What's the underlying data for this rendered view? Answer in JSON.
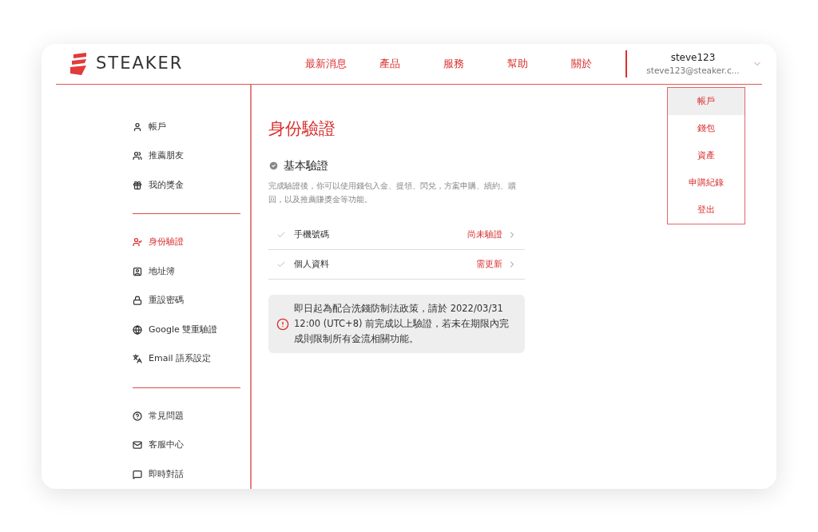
{
  "logo": {
    "text": "STEAKER"
  },
  "nav": [
    "最新消息",
    "產品",
    "服務",
    "幫助",
    "關於"
  ],
  "user": {
    "name": "steve123",
    "email": "steve123@steaker.c..."
  },
  "dropdown": [
    {
      "label": "帳戶",
      "selected": true
    },
    {
      "label": "錢包",
      "selected": false
    },
    {
      "label": "資產",
      "selected": false
    },
    {
      "label": "申購紀錄",
      "selected": false
    },
    {
      "label": "登出",
      "selected": false
    }
  ],
  "sidebar": {
    "groups": [
      [
        {
          "label": "帳戶",
          "selected": false
        },
        {
          "label": "推薦朋友",
          "selected": false
        },
        {
          "label": "我的獎金",
          "selected": false
        }
      ],
      [
        {
          "label": "身份驗證",
          "selected": true
        },
        {
          "label": "地址簿",
          "selected": false
        },
        {
          "label": "重設密碼",
          "selected": false
        },
        {
          "label": "Google 雙重驗證",
          "selected": false
        },
        {
          "label": "Email 語系設定",
          "selected": false
        }
      ],
      [
        {
          "label": "常見問題",
          "selected": false
        },
        {
          "label": "客服中心",
          "selected": false
        },
        {
          "label": "即時對話",
          "selected": false
        }
      ]
    ]
  },
  "page_title": "身份驗證",
  "section": {
    "title": "基本驗證",
    "description": "完成驗證後，你可以使用錢包入金、提領、閃兌，方案申購、續約、贖回，以及推薦賺獎金等功能。",
    "rows": [
      {
        "label": "手機號碼",
        "status": "尚未驗證"
      },
      {
        "label": "個人資料",
        "status": "需更新"
      }
    ]
  },
  "notice": "即日起為配合洗錢防制法政策，請於 2022/03/31 12:00 (UTC+8) 前完成以上驗證，若未在期限內完成則限制所有金流相關功能。"
}
